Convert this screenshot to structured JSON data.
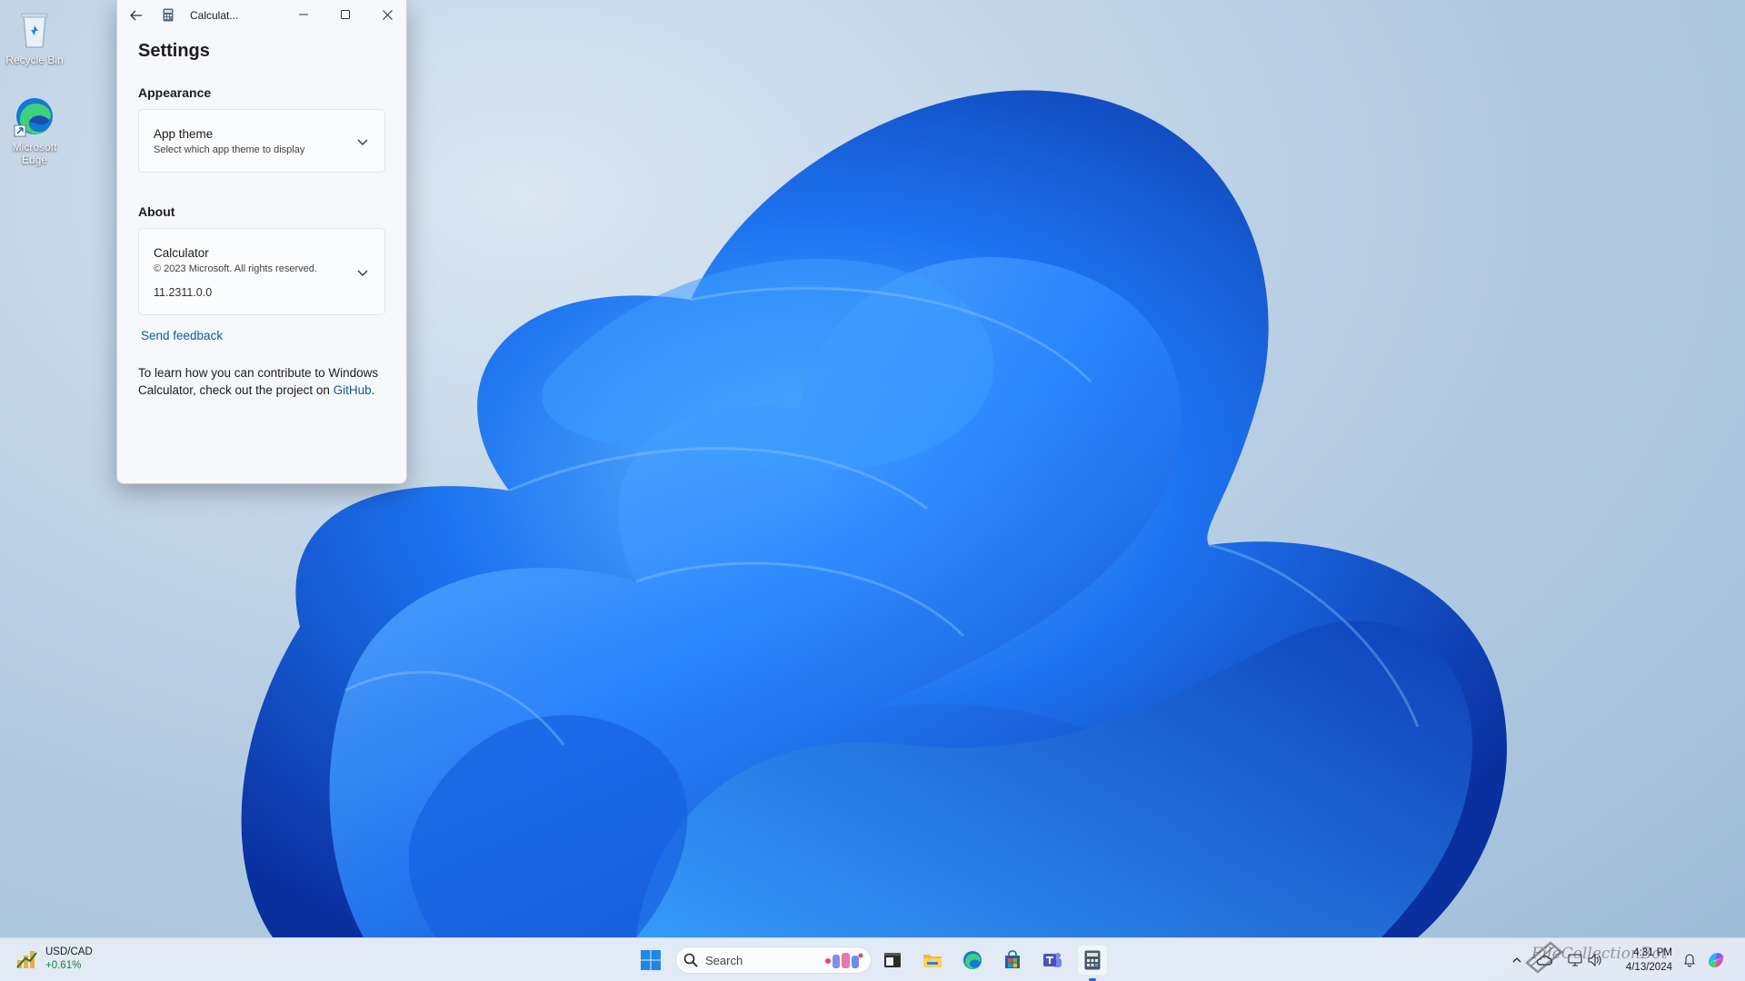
{
  "desktop": {
    "icons": [
      {
        "label": "Recycle Bin",
        "icon": "recycle-bin-icon"
      },
      {
        "label": "Microsoft Edge",
        "icon": "edge-icon"
      }
    ]
  },
  "window": {
    "title": "Calculat...",
    "controls": {
      "back": "back-arrow-icon",
      "minimize": "minimize-icon",
      "maximize": "maximize-icon",
      "close": "close-icon"
    },
    "page_title": "Settings",
    "appearance": {
      "section_label": "Appearance",
      "theme_title": "App theme",
      "theme_subtitle": "Select which app theme to display"
    },
    "about": {
      "section_label": "About",
      "app_name": "Calculator",
      "copyright": "© 2023 Microsoft. All rights reserved.",
      "version": "11.2311.0.0"
    },
    "send_feedback": "Send feedback",
    "contribute_text": "To learn how you can contribute to Windows Calculator, check out the project on",
    "github_link": "GitHub",
    "contribute_end": "."
  },
  "taskbar": {
    "widget": {
      "name": "USD/CAD",
      "change": "+0.61%"
    },
    "search": {
      "placeholder": "Search"
    },
    "apps": [
      "start-icon",
      "terminal-icon",
      "file-explorer-icon",
      "edge-icon",
      "store-icon",
      "teams-icon",
      "calculator-icon"
    ],
    "tray": {
      "time": "4:31 PM",
      "date": "4/13/2024"
    },
    "watermark": "FileCollectionBot"
  },
  "colors": {
    "accent": "#0c5a9c",
    "window_bg": "#f6f8fb",
    "taskbar_bg": "#e4ecf6",
    "bloom_dark": "#0b3fb8",
    "bloom_light": "#2f9bff"
  }
}
